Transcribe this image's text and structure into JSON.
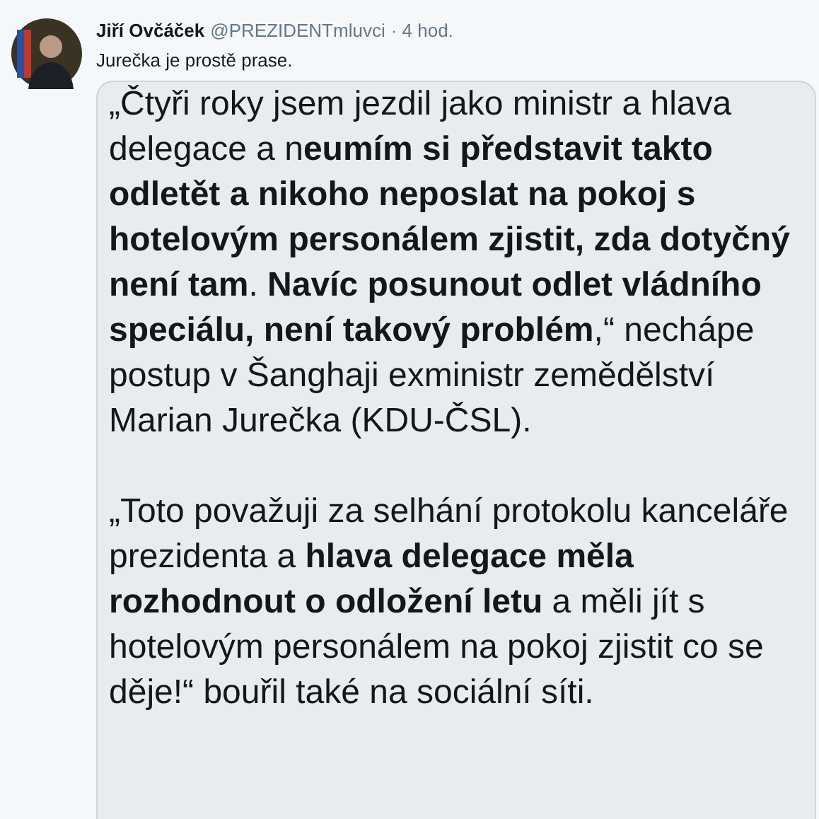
{
  "tweet": {
    "author": {
      "name": "Jiří Ovčáček",
      "handle": "@PREZIDENTmluvci",
      "time": "· 4 hod."
    },
    "text": "Jurečka je prostě prase.",
    "attached_text": {
      "paragraphs": [
        "„Čtyři roky jsem jezdil jako ministr a hlava delegace a n**eumím si představit takto odletět a nikoho neposlat na pokoj s hotelovým personálem zjistit, zda dotyčný není tam**. **Navíc posunout odlet vládního speciálu, není takový problém**,“ nechápe postup v Šanghaji exministr zemědělství Marian Jurečka (KDU-ČSL).",
        "„Toto považuji za selhání protokolu kanceláře prezidenta a **hlava delegace měla rozhodnout o odložení letu** a měli jít s hotelovým personálem na pokoj zjistit co se děje!“ bouřil také na sociální síti."
      ]
    }
  }
}
